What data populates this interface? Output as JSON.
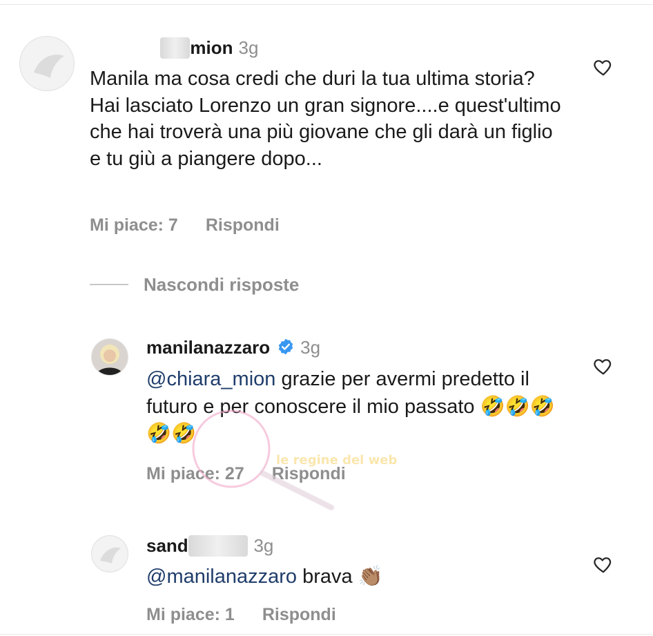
{
  "comments": [
    {
      "username_visible": "mion",
      "time": "3g",
      "text": "Manila ma cosa credi che duri la tua ultima storia? Hai lasciato Lorenzo un gran signore....e quest'ultimo che hai troverà una più giovane che gli darà un figlio e tu giù a piangere dopo...",
      "likes": "Mi piace: 7",
      "reply": "Rispondi"
    }
  ],
  "hide_replies": "Nascondi risposte",
  "replies": [
    {
      "username": "manilanazzaro",
      "time": "3g",
      "mention": "@chiara_mion",
      "text": " grazie per avermi predetto il futuro e per conoscere il mio passato ",
      "emoji": "🤣🤣🤣🤣🤣",
      "likes": "Mi piace: 27",
      "reply": "Rispondi"
    },
    {
      "username_visible": "sand",
      "time": "3g",
      "mention": "@manilanazzaro",
      "text": " brava ",
      "emoji": "👏🏽",
      "likes": "Mi piace: 1",
      "reply": "Rispondi"
    }
  ],
  "watermark_text": "le regine del web",
  "icons": {
    "like": "heart-outline-icon",
    "verified": "verified-badge-icon"
  },
  "colors": {
    "mention": "#1f3d6b",
    "muted": "#8e8e8e",
    "verified": "#3897f0"
  }
}
